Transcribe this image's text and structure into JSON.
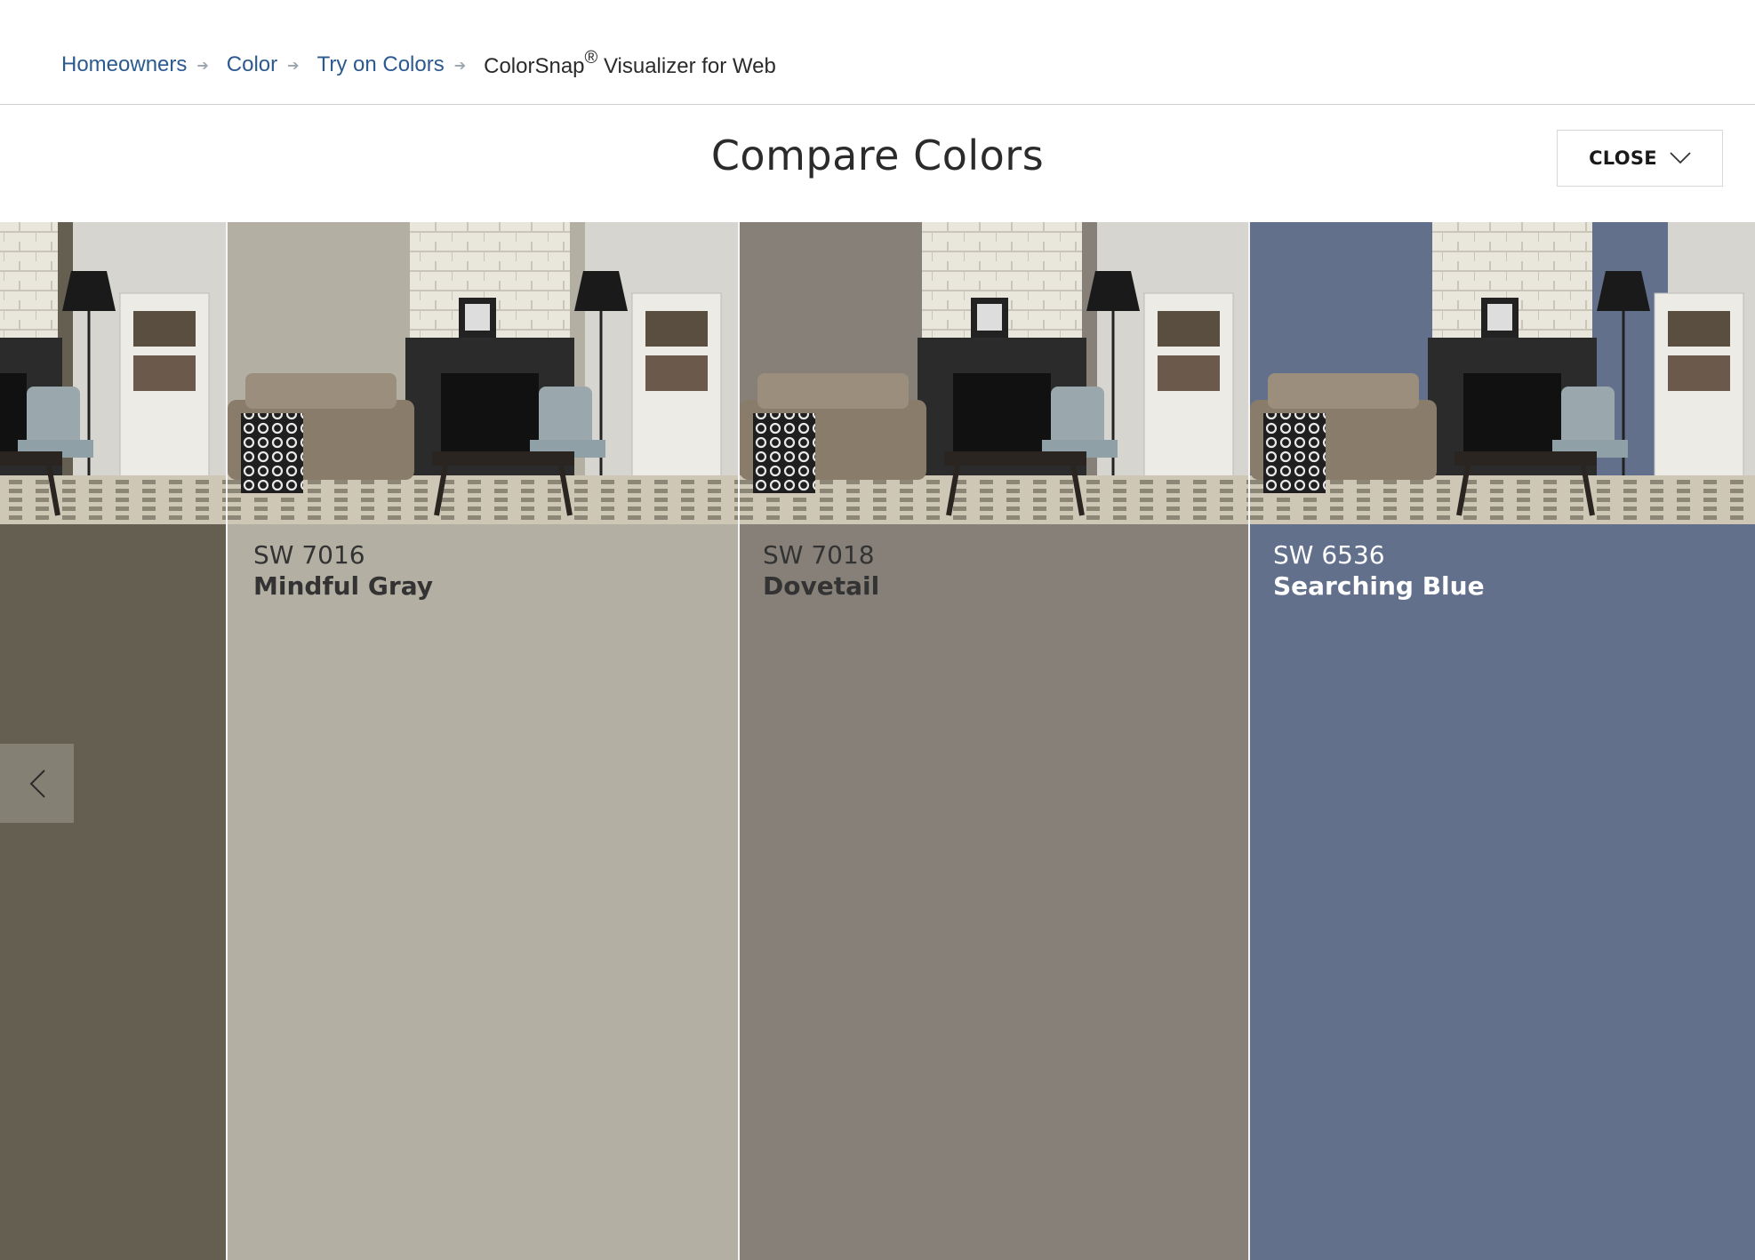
{
  "breadcrumb": {
    "items": [
      "Homeowners",
      "Color",
      "Try on Colors"
    ],
    "separator": "➔",
    "current_main": "ColorSnap",
    "current_reg": "®",
    "current_rest": " Visualizer for Web"
  },
  "header": {
    "title": "Compare Colors",
    "close_label": "CLOSE"
  },
  "colors": [
    {
      "code": "",
      "name": "",
      "hex": "#655f52",
      "text": "#ffffff"
    },
    {
      "code": "SW 7016",
      "name": "Mindful Gray",
      "hex": "#b3afa3",
      "text": "#333333"
    },
    {
      "code": "SW 7018",
      "name": "Dovetail",
      "hex": "#868079",
      "text": "#333333"
    },
    {
      "code": "SW 6536",
      "name": "Searching Blue",
      "hex": "#63708c",
      "text": "#ffffff"
    }
  ],
  "icons": {
    "close": "chevron-down-icon",
    "prev": "chevron-left-icon",
    "room": "living-room-photo"
  }
}
